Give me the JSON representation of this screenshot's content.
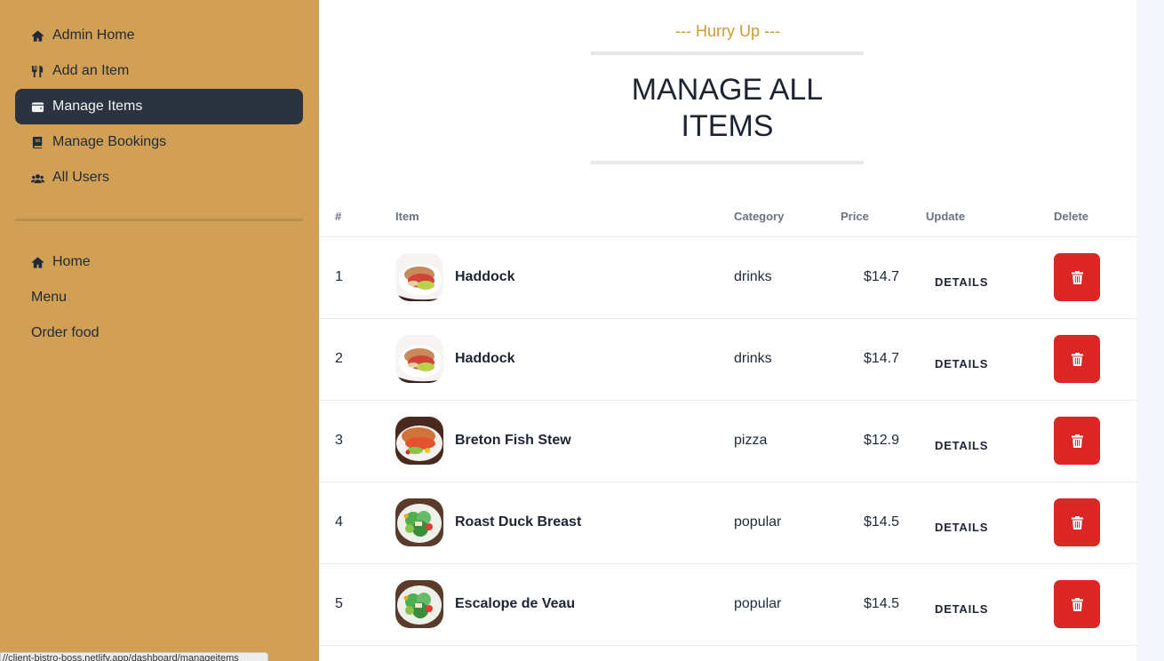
{
  "sidebar": {
    "primary_items": [
      {
        "label": "Admin Home",
        "icon": "home-icon"
      },
      {
        "label": "Add an Item",
        "icon": "utensils-icon"
      },
      {
        "label": "Manage Items",
        "icon": "wallet-icon",
        "active": true
      },
      {
        "label": "Manage Bookings",
        "icon": "book-icon"
      },
      {
        "label": "All Users",
        "icon": "users-icon"
      }
    ],
    "secondary_items": [
      {
        "label": "Home",
        "icon": "home-icon"
      },
      {
        "label": "Menu"
      },
      {
        "label": "Order food"
      }
    ]
  },
  "header": {
    "subtitle": "--- Hurry Up ---",
    "title": "MANAGE ALL ITEMS"
  },
  "table": {
    "columns": [
      "#",
      "Item",
      "Category",
      "Price",
      "Update",
      "Delete"
    ],
    "rows": [
      {
        "num": "1",
        "name": "Haddock",
        "category": "drinks",
        "price": "$14.7",
        "update": "DETAILS"
      },
      {
        "num": "2",
        "name": "Haddock",
        "category": "drinks",
        "price": "$14.7",
        "update": "DETAILS"
      },
      {
        "num": "3",
        "name": "Breton Fish Stew",
        "category": "pizza",
        "price": "$12.9",
        "update": "DETAILS"
      },
      {
        "num": "4",
        "name": "Roast Duck Breast",
        "category": "popular",
        "price": "$14.5",
        "update": "DETAILS"
      },
      {
        "num": "5",
        "name": "Escalope de Veau",
        "category": "popular",
        "price": "$14.5",
        "update": "DETAILS"
      }
    ]
  },
  "status_bar": {
    "url": "//client-bistro-boss.netlify.app/dashboard/manageitems"
  },
  "colors": {
    "sidebar_bg": "#d1a054",
    "active_item_bg": "#2b3240",
    "accent": "#d19a2a",
    "delete_button": "#dc2626"
  }
}
